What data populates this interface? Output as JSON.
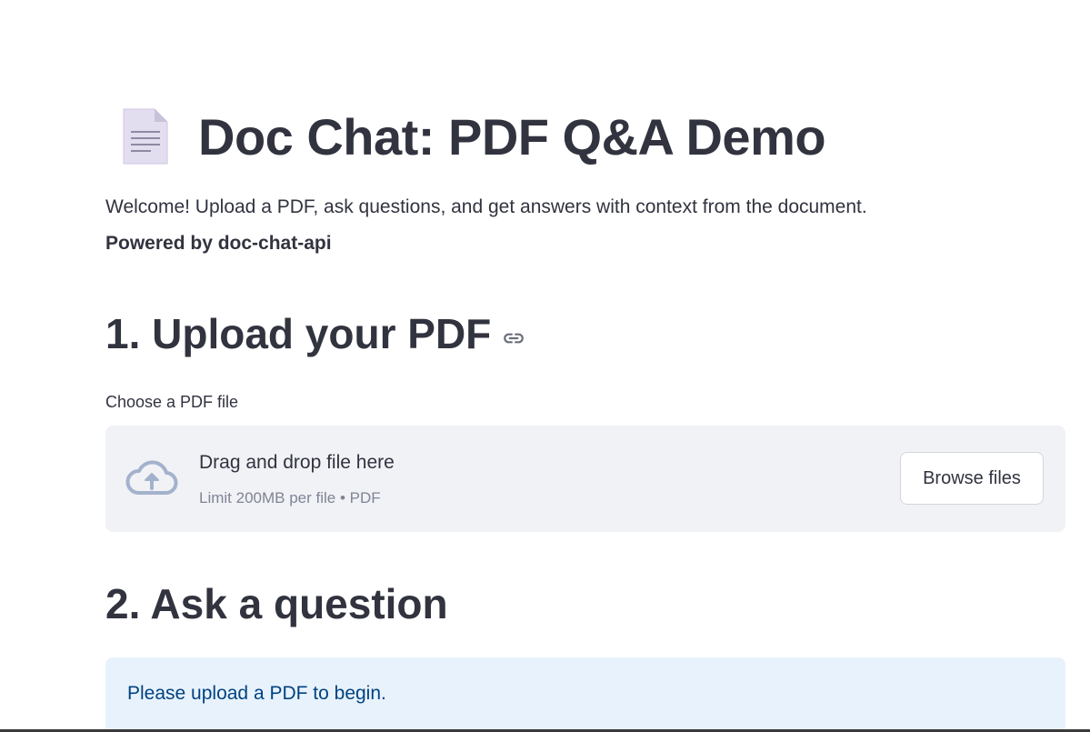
{
  "header": {
    "title": "Doc Chat: PDF Q&A Demo",
    "icon": "document-icon"
  },
  "intro": {
    "welcome_text": "Welcome! Upload a PDF, ask questions, and get answers with context from the document.",
    "powered_by": "Powered by doc-chat-api"
  },
  "upload_section": {
    "heading": "1. Upload your PDF",
    "link_icon": "link-icon",
    "file_label": "Choose a PDF file",
    "dropzone": {
      "icon": "cloud-upload-icon",
      "primary_text": "Drag and drop file here",
      "limit_text": "Limit 200MB per file • PDF",
      "browse_label": "Browse files"
    }
  },
  "ask_section": {
    "heading": "2. Ask a question",
    "info_message": "Please upload a PDF to begin."
  },
  "colors": {
    "text": "#31333f",
    "muted": "#808495",
    "dropzone_bg": "#f0f2f6",
    "info_bg": "#e8f2fc",
    "info_text": "#004280",
    "icon_blue_gray": "#a3b2cc"
  }
}
